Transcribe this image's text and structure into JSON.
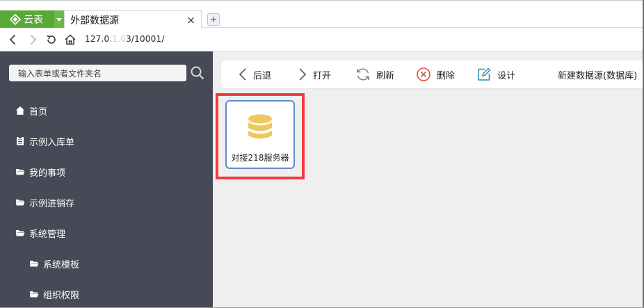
{
  "browser": {
    "app_tab_label": "云表",
    "page_tab_title": "外部数据源",
    "close_glyph": "×",
    "url_prefix": "127.0",
    "url_blur": ".1.0",
    "url_suffix": "3/10001/"
  },
  "sidebar": {
    "search_placeholder": "输入表单或者文件夹名",
    "items": [
      {
        "label": "首页",
        "icon": "home-icon"
      },
      {
        "label": "示例入库单",
        "icon": "document-icon"
      },
      {
        "label": "我的事项",
        "icon": "folder-icon"
      },
      {
        "label": "示例进销存",
        "icon": "folder-icon"
      },
      {
        "label": "系统管理",
        "icon": "folder-open-icon"
      },
      {
        "label": "系统模板",
        "icon": "folder-icon"
      },
      {
        "label": "组织权限",
        "icon": "folder-icon"
      }
    ]
  },
  "toolbar": {
    "back_label": "后退",
    "open_label": "打开",
    "refresh_label": "刷新",
    "delete_label": "删除",
    "design_label": "设计",
    "new_label": "新建数据源(数据库)"
  },
  "content": {
    "items": [
      {
        "label": "对接218服务器",
        "icon": "database-icon"
      }
    ]
  },
  "colors": {
    "brand_green": "#5aa835",
    "sidebar_bg": "#464a56",
    "highlight_red": "#f23c3c",
    "card_border": "#5d8ccc",
    "database_yellow": "#ecc95a"
  }
}
